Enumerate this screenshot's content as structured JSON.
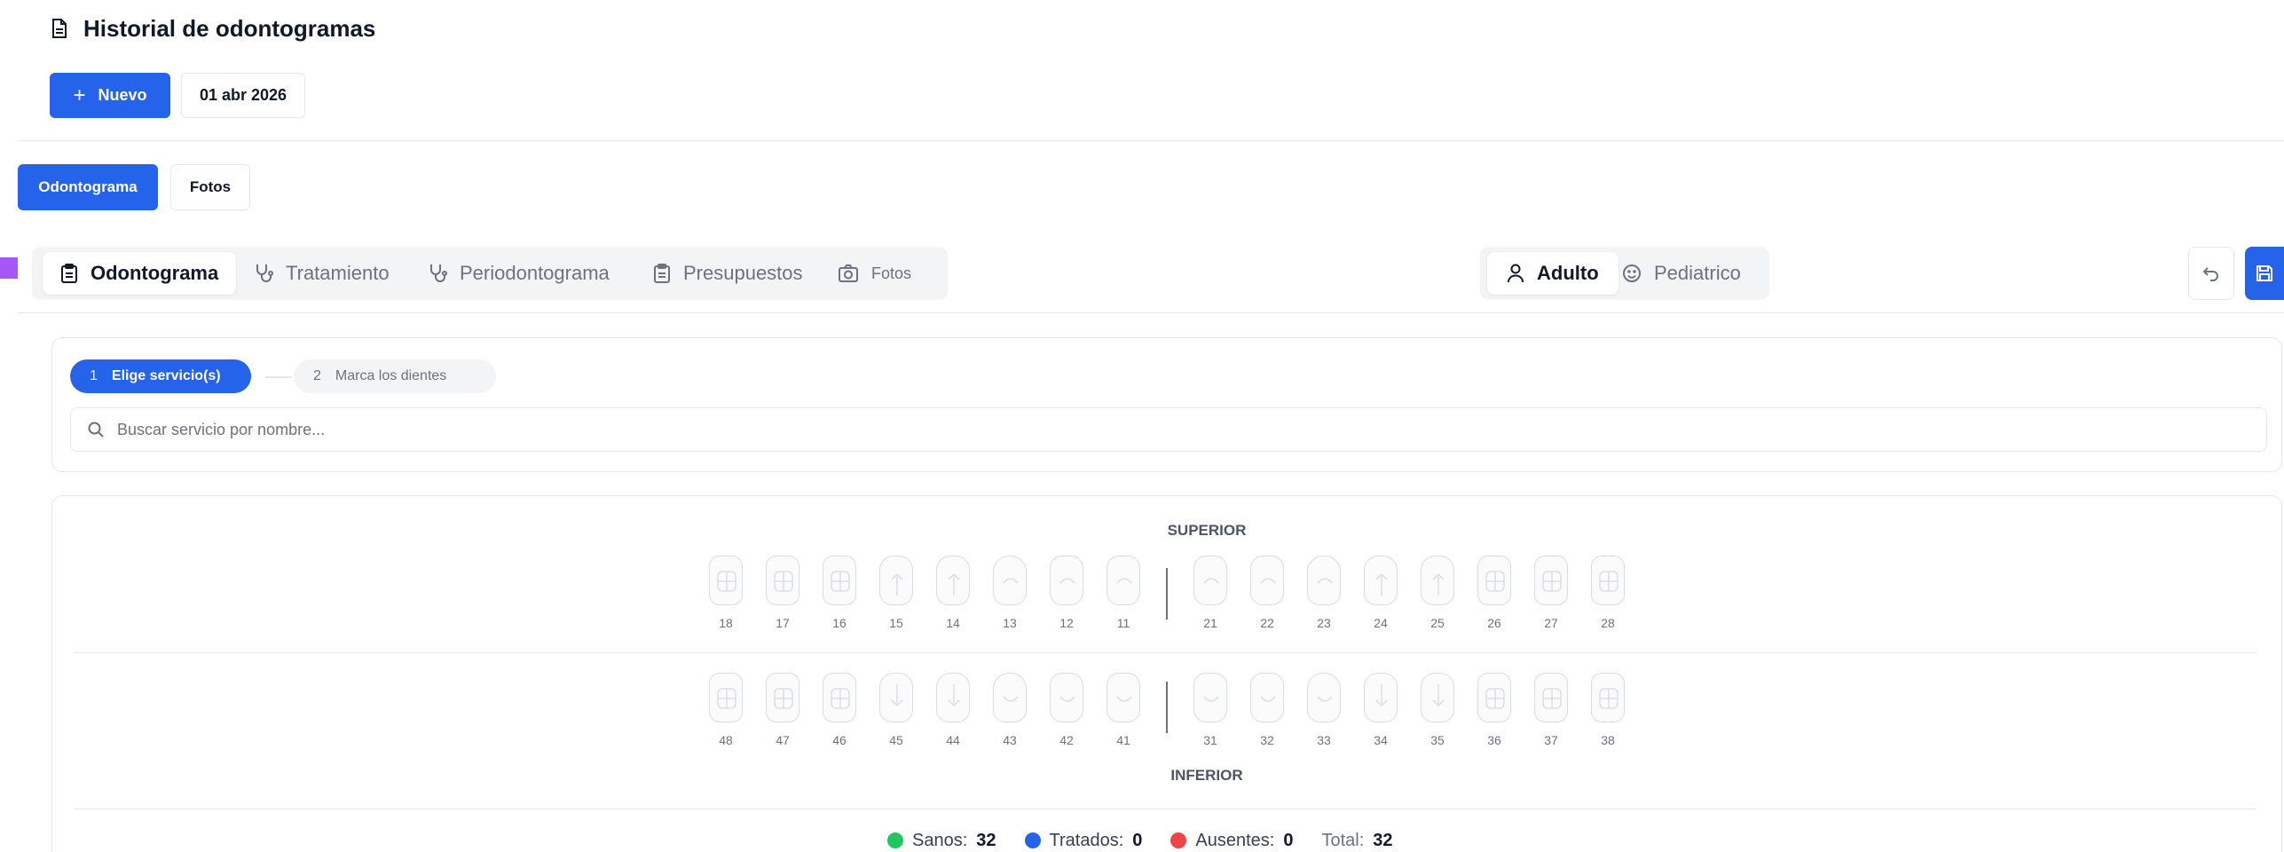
{
  "page": {
    "title": "Historial de odontogramas",
    "title_icon": "document-icon"
  },
  "toolbar": {
    "new_label": "Nuevo",
    "new_icon": "plus",
    "date": "01 abr 2026"
  },
  "view_tabs": [
    {
      "label": "Odontograma",
      "active": true
    },
    {
      "label": "Fotos",
      "active": false
    }
  ],
  "main_tabs": [
    {
      "label": "Odontograma",
      "icon": "clipboard-icon",
      "active": true
    },
    {
      "label": "Tratamiento",
      "icon": "stethoscope-icon",
      "active": false
    },
    {
      "label": "Periodontograma",
      "icon": "stethoscope-icon",
      "active": false
    },
    {
      "label": "Presupuestos",
      "icon": "clipboard-icon",
      "active": false
    },
    {
      "label": "Fotos",
      "icon": "camera-icon",
      "active": false
    }
  ],
  "age_toggle": [
    {
      "label": "Adulto",
      "icon": "user-icon",
      "active": true
    },
    {
      "label": "Pediatrico",
      "icon": "smile-icon",
      "active": false
    }
  ],
  "steps": [
    {
      "number": "1",
      "label": "Elige servicio(s)",
      "active": true
    },
    {
      "number": "2",
      "label": "Marca los dientes",
      "active": false
    }
  ],
  "search": {
    "placeholder": "Buscar servicio por nombre..."
  },
  "odontogram": {
    "upper_label": "SUPERIOR",
    "lower_label": "INFERIOR",
    "upper_teeth": [
      "18",
      "17",
      "16",
      "15",
      "14",
      "13",
      "12",
      "11",
      "21",
      "22",
      "23",
      "24",
      "25",
      "26",
      "27",
      "28"
    ],
    "lower_teeth": [
      "48",
      "47",
      "46",
      "45",
      "44",
      "43",
      "42",
      "41",
      "31",
      "32",
      "33",
      "34",
      "35",
      "36",
      "37",
      "38"
    ]
  },
  "legend": {
    "sanos_label": "Sanos:",
    "sanos_value": "32",
    "tratados_label": "Tratados:",
    "tratados_value": "0",
    "ausentes_label": "Ausentes:",
    "ausentes_value": "0",
    "total_label": "Total:",
    "total_value": "32"
  },
  "colors": {
    "primary": "#2563eb",
    "healthy": "#22c55e",
    "treated": "#2563eb",
    "absent": "#ef4444",
    "accent_marker": "#a855f7"
  }
}
